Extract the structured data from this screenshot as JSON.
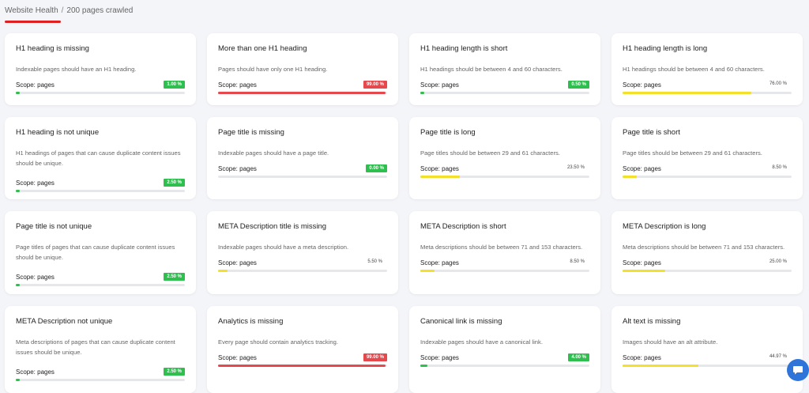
{
  "breadcrumb": {
    "root": "Website Health",
    "separator": "/",
    "current": "200 pages crawled"
  },
  "colors": {
    "green": "#2fbf4f",
    "red": "#e5484d",
    "yellow": "#f2e02a",
    "track": "#e6e7ea",
    "chat": "#2f74d8"
  },
  "cards": [
    {
      "title": "H1 heading is missing",
      "description": "Indexable pages should have an H1 heading.",
      "scope": "Scope: pages",
      "value": "1.00 %",
      "percent": 1.0,
      "status": "green"
    },
    {
      "title": "More than one H1 heading",
      "description": "Pages should have only one H1 heading.",
      "scope": "Scope: pages",
      "value": "99.00 %",
      "percent": 99.0,
      "status": "red"
    },
    {
      "title": "H1 heading length is short",
      "description": "H1 headings should be between 4 and 60 characters.",
      "scope": "Scope: pages",
      "value": "0.50 %",
      "percent": 0.5,
      "status": "green"
    },
    {
      "title": "H1 heading length is long",
      "description": "H1 headings should be between 4 and 60 characters.",
      "scope": "Scope: pages",
      "value": "76.00 %",
      "percent": 76.0,
      "status": "yellow"
    },
    {
      "title": "H1 heading is not unique",
      "description": "H1 headings of pages that can cause duplicate content issues should be unique.",
      "scope": "Scope: pages",
      "value": "2.50 %",
      "percent": 2.5,
      "status": "green"
    },
    {
      "title": "Page title is missing",
      "description": "Indexable pages should have a page title.",
      "scope": "Scope: pages",
      "value": "0.00 %",
      "percent": 0.0,
      "status": "green"
    },
    {
      "title": "Page title is long",
      "description": "Page titles should be between 29 and 61 characters.",
      "scope": "Scope: pages",
      "value": "23.50 %",
      "percent": 23.5,
      "status": "yellow"
    },
    {
      "title": "Page title is short",
      "description": "Page titles should be between 29 and 61 characters.",
      "scope": "Scope: pages",
      "value": "8.50 %",
      "percent": 8.5,
      "status": "yellow"
    },
    {
      "title": "Page title is not unique",
      "description": "Page titles of pages that can cause duplicate content issues should be unique.",
      "scope": "Scope: pages",
      "value": "2.50 %",
      "percent": 2.5,
      "status": "green"
    },
    {
      "title": "META Description title is missing",
      "description": "Indexable pages should have a meta description.",
      "scope": "Scope: pages",
      "value": "5.50 %",
      "percent": 5.5,
      "status": "yellow"
    },
    {
      "title": "META Description is short",
      "description": "Meta descriptions should be between 71 and 153 characters.",
      "scope": "Scope: pages",
      "value": "8.50 %",
      "percent": 8.5,
      "status": "yellow"
    },
    {
      "title": "META Description is long",
      "description": "Meta descriptions should be between 71 and 153 characters.",
      "scope": "Scope: pages",
      "value": "25.00 %",
      "percent": 25.0,
      "status": "yellow"
    },
    {
      "title": "META Description not unique",
      "description": "Meta descriptions of pages that can cause duplicate content issues should be unique.",
      "scope": "Scope: pages",
      "value": "2.50 %",
      "percent": 2.5,
      "status": "green"
    },
    {
      "title": "Analytics is missing",
      "description": "Every page should contain analytics tracking.",
      "scope": "Scope: pages",
      "value": "99.00 %",
      "percent": 99.0,
      "status": "red"
    },
    {
      "title": "Canonical link is missing",
      "description": "Indexable pages should have a canonical link.",
      "scope": "Scope: pages",
      "value": "4.00 %",
      "percent": 4.0,
      "status": "green"
    },
    {
      "title": "Alt text is missing",
      "description": "Images should have an alt attribute.",
      "scope": "Scope: pages",
      "value": "44.97 %",
      "percent": 44.97,
      "status": "yellow"
    }
  ],
  "chat": {
    "icon": "chat-bubble-icon"
  }
}
